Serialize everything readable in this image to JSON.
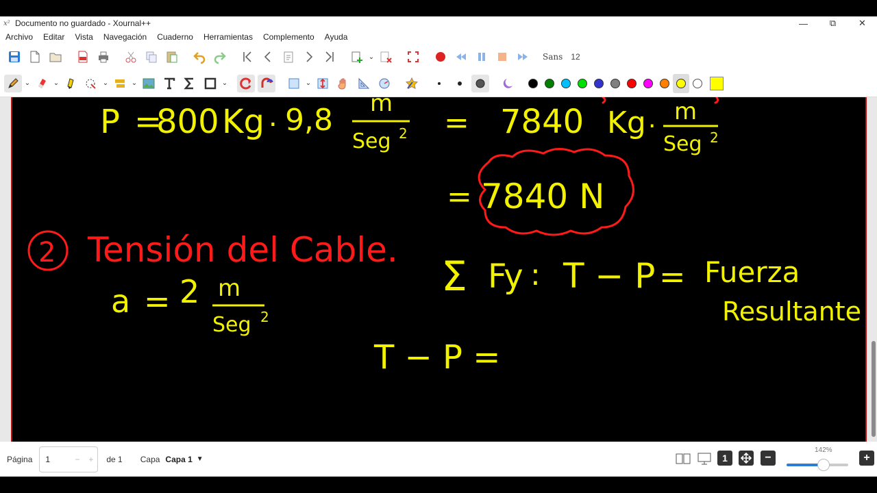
{
  "window": {
    "title": "Documento no guardado - Xournal++",
    "app_icon": "x²",
    "minimize": "—",
    "maximize": "⧉",
    "close": "✕"
  },
  "menu": [
    "Archivo",
    "Editar",
    "Vista",
    "Navegación",
    "Cuaderno",
    "Herramientas",
    "Complemento",
    "Ayuda"
  ],
  "toolbar": {
    "font_name": "Sans",
    "font_size": "12"
  },
  "colors": {
    "palette": [
      "#000000",
      "#008000",
      "#00c0ff",
      "#00e000",
      "#3333cc",
      "#808080",
      "#ff0000",
      "#ff00ff",
      "#ff8000",
      "#ffff00",
      "#ffffff"
    ],
    "selected": "#ffff00",
    "current_swatch": "#ffff00",
    "ink_yellow": "#f2f200",
    "ink_red": "#ff1a1a"
  },
  "canvas": {
    "weight_line": {
      "P": "P",
      "eq1": "=",
      "mass": "800",
      "kg1": "Kg",
      "dot1": ".",
      "g": "9,8",
      "m1": "m",
      "seg1": "Seg",
      "exp1": "2",
      "eq2": "=",
      "result": "7840",
      "kg2": "Kg",
      "dot2": ".",
      "m2": "m",
      "seg2": "Seg",
      "exp2": "2"
    },
    "weight_result": {
      "eq": "=",
      "value": "7840 N"
    },
    "tension_title": {
      "number": "2",
      "text": "Tensión del Cable."
    },
    "acceleration": {
      "a": "a",
      "eq": "=",
      "value": "2",
      "m": "m",
      "seg": "Seg",
      "exp": "2"
    },
    "sum_forces": {
      "sigma": "Σ",
      "fy": "Fy",
      "colon": ":",
      "expr": "T − P",
      "eq": "=",
      "word1": "Fuerza",
      "word2": "Resultante"
    },
    "tp_line": "T − P ="
  },
  "status": {
    "page_label": "Página",
    "page_value": "1",
    "page_minus": "−",
    "page_plus": "+",
    "of_label": "de 1",
    "layer_label": "Capa",
    "layer_value": "Capa 1",
    "zoom_percent": "142%",
    "zoom_level": 0.6
  }
}
